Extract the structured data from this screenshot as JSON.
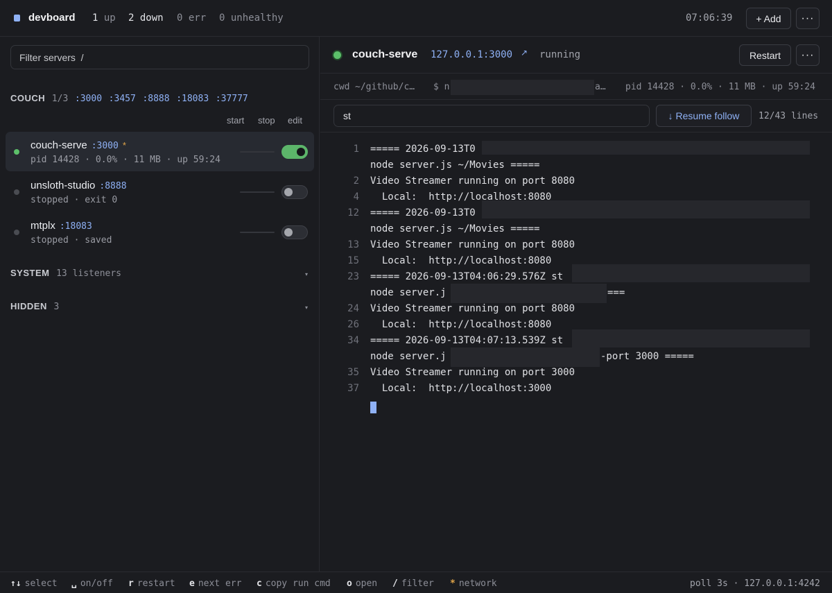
{
  "topbar": {
    "title": "devboard",
    "stats": [
      {
        "n": "1",
        "label": "up"
      },
      {
        "n": "2",
        "label": "down"
      },
      {
        "n": "0",
        "label": "err"
      },
      {
        "n": "0",
        "label": "unhealthy"
      }
    ],
    "clock": "07:06:39",
    "add_label": "+ Add",
    "more_label": "···"
  },
  "sidebar": {
    "filter_placeholder": "Filter servers  /",
    "group": {
      "name": "COUCH",
      "count": "1/3",
      "ports": [
        ":3000",
        ":3457",
        ":8888",
        ":18083",
        ":37777"
      ],
      "columns": [
        "start",
        "stop",
        "edit"
      ]
    },
    "servers": [
      {
        "name": "couch-serve",
        "port": ":3000",
        "star": "*",
        "meta": "pid 14428 · 0.0% · 11 MB · up 59:24",
        "running": true
      },
      {
        "name": "unsloth-studio",
        "port": ":8888",
        "star": "",
        "meta": "stopped · exit 0",
        "running": false
      },
      {
        "name": "mtplx",
        "port": ":18083",
        "star": "",
        "meta": "stopped · saved",
        "running": false
      }
    ],
    "system": {
      "name": "SYSTEM",
      "count": "13 listeners"
    },
    "hidden": {
      "name": "HIDDEN",
      "count": "3"
    },
    "caret": "▾"
  },
  "main": {
    "title": "couch-serve",
    "address": "127.0.0.1:3000",
    "address_arrow": "↗",
    "status": "running",
    "restart_label": "Restart",
    "more_label": "···",
    "info": {
      "cwd_label": "cwd",
      "cwd": "~/github/c…",
      "cmd_prefix": "$ n",
      "cmd_tail": "a…",
      "stats": "pid 14428 · 0.0% · 11 MB · up 59:24"
    },
    "search_value": "st",
    "resume_label": "↓ Resume follow",
    "line_count": "12/43 lines",
    "log_lines": [
      {
        "n": "1",
        "text": "===== 2026-09-13T0"
      },
      {
        "n": "",
        "text": "node server.js ~/Movies ====="
      },
      {
        "n": "2",
        "text": "Video Streamer running on port 8080"
      },
      {
        "n": "4",
        "text": "  Local:  http://localhost:8080"
      },
      {
        "n": "12",
        "text": "===== 2026-09-13T0"
      },
      {
        "n": "",
        "text": "node server.js ~/Movies ====="
      },
      {
        "n": "13",
        "text": "Video Streamer running on port 8080"
      },
      {
        "n": "15",
        "text": "  Local:  http://localhost:8080"
      },
      {
        "n": "23",
        "text": "===== 2026-09-13T04:06:29.576Z st"
      },
      {
        "n": "",
        "text": "node server.j"
      },
      {
        "n": "24",
        "text": "Video Streamer running on port 8080"
      },
      {
        "n": "26",
        "text": "  Local:  http://localhost:8080"
      },
      {
        "n": "34",
        "text": "===== 2026-09-13T04:07:13.539Z st"
      },
      {
        "n": "",
        "text": "node server.j"
      },
      {
        "n": "35",
        "text": "Video Streamer running on port 3000"
      },
      {
        "n": "37",
        "text": "  Local:  http://localhost:3000"
      }
    ],
    "log_tails": [
      "===",
      "-port 3000 ====="
    ]
  },
  "footer": {
    "hints": [
      {
        "key": "↑↓",
        "label": "select"
      },
      {
        "key": "␣",
        "label": "on/off"
      },
      {
        "key": "r",
        "label": "restart"
      },
      {
        "key": "e",
        "label": "next err"
      },
      {
        "key": "c",
        "label": "copy run cmd"
      },
      {
        "key": "o",
        "label": "open"
      },
      {
        "key": "/",
        "label": "filter"
      },
      {
        "key": "*",
        "label": "network"
      }
    ],
    "right": "poll 3s · 127.0.0.1:4242"
  },
  "colors": {
    "accent": "#8fb1f5",
    "running": "#5cc06a",
    "star": "#e2a64a"
  }
}
